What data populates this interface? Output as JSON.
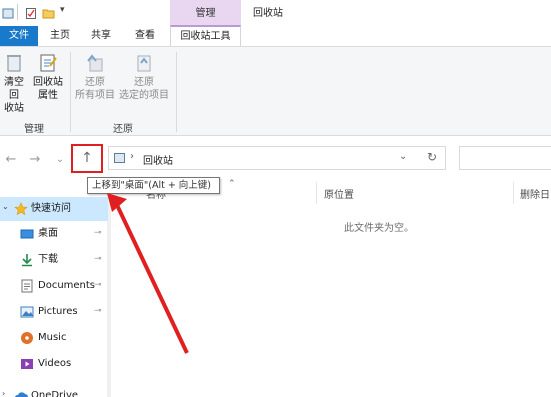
{
  "titlebar": {
    "context_group": "管理",
    "window_title": "回收站"
  },
  "tabs": {
    "file": "文件",
    "home": "主页",
    "share": "共享",
    "view": "查看",
    "recycle_tools": "回收站工具"
  },
  "ribbon": {
    "empty_bin_line1": "清空回",
    "empty_bin_line2": "收站",
    "bin_props_line1": "回收站",
    "bin_props_line2": "属性",
    "restore_all_line1": "还原",
    "restore_all_line2": "所有项目",
    "restore_selected_line1": "还原",
    "restore_selected_line2": "选定的项目",
    "group_manage": "管理",
    "group_restore": "还原"
  },
  "address": {
    "separator": "›",
    "location": "回收站",
    "dropdown_glyph": "⌄",
    "refresh_glyph": "↻"
  },
  "nav_buttons": {
    "back": "←",
    "forward": "→",
    "recent": "⌄",
    "up": "↑"
  },
  "tooltip": "上移到\"桌面\"(Alt + 向上键)",
  "nav_pane": {
    "quick_access": "快速访问",
    "items": [
      {
        "label": "桌面"
      },
      {
        "label": "下载"
      },
      {
        "label": "Documents"
      },
      {
        "label": "Pictures"
      },
      {
        "label": "Music"
      },
      {
        "label": "Videos"
      },
      {
        "label": "OneDrive"
      }
    ],
    "pin_glyph": "📌"
  },
  "columns": {
    "name": "名称",
    "original_location": "原位置",
    "date_deleted": "删除日"
  },
  "empty_message": "此文件夹为空。",
  "colors": {
    "file_tab": "#1979ca",
    "context_tab": "#e9d7f1",
    "selected_nav": "#cce8ff",
    "annotation": "#e02020"
  }
}
